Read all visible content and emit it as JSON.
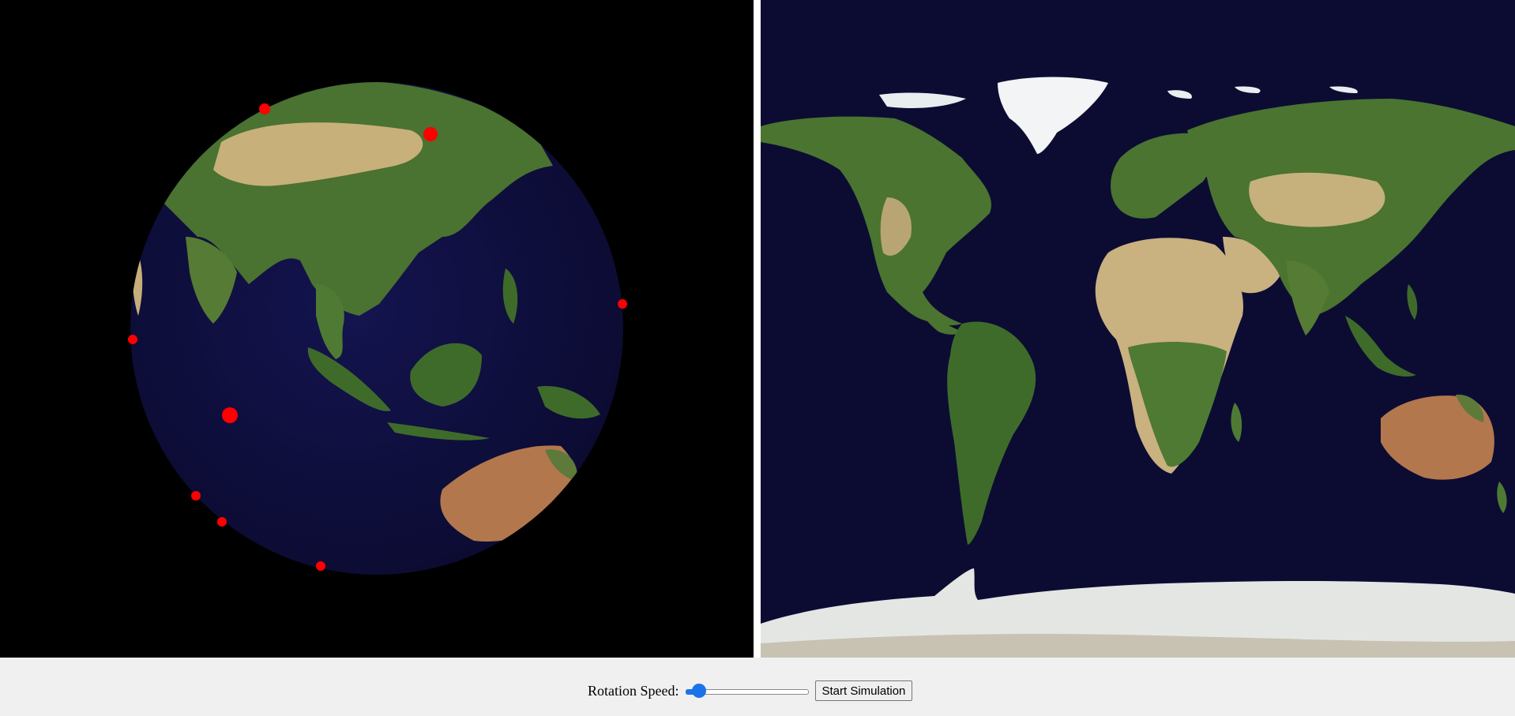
{
  "controls": {
    "speed_label": "Rotation Speed:",
    "speed_value": 0.06,
    "start_label": "Start Simulation"
  },
  "globe": {
    "ocean_color": "#0c0c3b",
    "land_color": "#3f6a2a",
    "desert_color": "#c8b27a",
    "marker_color": "#ff0000",
    "marker_count": 9
  },
  "map": {
    "ocean_color": "#0c0c33",
    "ice_color": "#e9eef0"
  }
}
